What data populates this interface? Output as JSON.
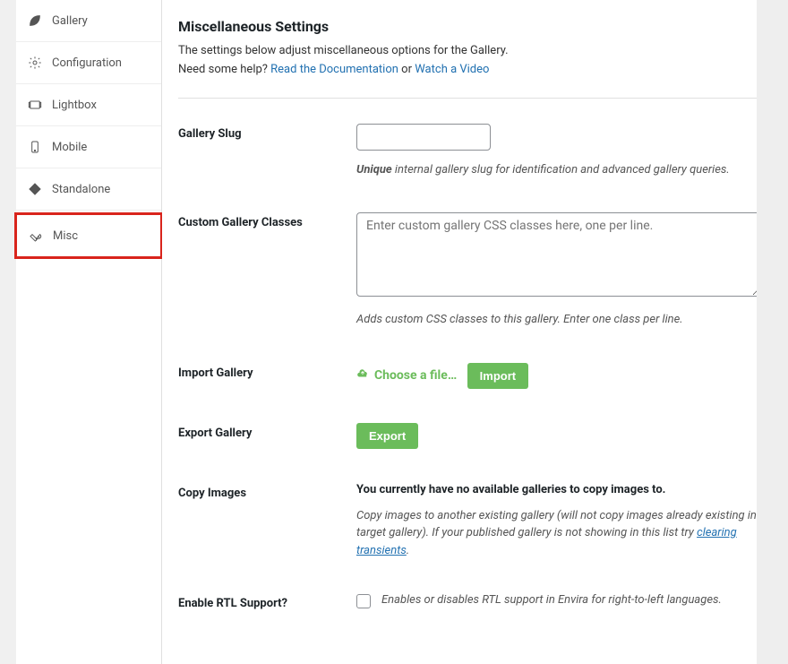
{
  "sidebar": {
    "items": [
      {
        "label": "Gallery",
        "icon": "leaf"
      },
      {
        "label": "Configuration",
        "icon": "gear"
      },
      {
        "label": "Lightbox",
        "icon": "lightbox"
      },
      {
        "label": "Mobile",
        "icon": "mobile"
      },
      {
        "label": "Standalone",
        "icon": "diamond"
      },
      {
        "label": "Misc",
        "icon": "wrench"
      }
    ]
  },
  "main": {
    "title": "Miscellaneous Settings",
    "intro_line1": "The settings below adjust miscellaneous options for the Gallery.",
    "intro_help_prefix": "Need some help? ",
    "intro_link_doc": "Read the Documentation",
    "intro_or": " or ",
    "intro_link_video": "Watch a Video",
    "fields": {
      "slug": {
        "label": "Gallery Slug",
        "value": "",
        "help_strong": "Unique",
        "help_rest": " internal gallery slug for identification and advanced gallery queries."
      },
      "classes": {
        "label": "Custom Gallery Classes",
        "placeholder": "Enter custom gallery CSS classes here, one per line.",
        "value": "",
        "help": "Adds custom CSS classes to this gallery. Enter one class per line."
      },
      "import": {
        "label": "Import Gallery",
        "choose": "Choose a file…",
        "button": "Import"
      },
      "export": {
        "label": "Export Gallery",
        "button": "Export"
      },
      "copy": {
        "label": "Copy Images",
        "msg": "You currently have no available galleries to copy images to.",
        "help_1": "Copy images to another existing gallery (will not copy images already existing in target gallery). If your published gallery is not showing in this list try ",
        "help_link": "clearing transients",
        "help_2": "."
      },
      "rtl": {
        "label": "Enable RTL Support?",
        "help": "Enables or disables RTL support in Envira for right-to-left languages."
      }
    }
  }
}
